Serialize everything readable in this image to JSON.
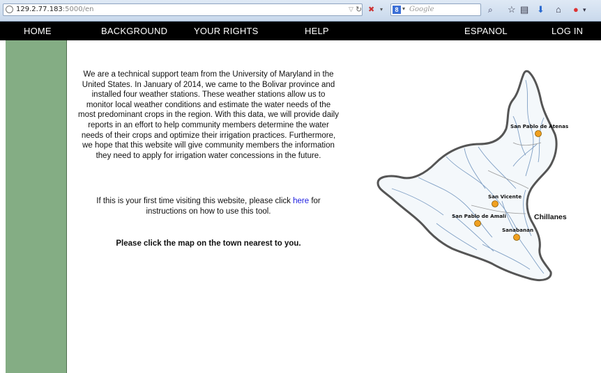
{
  "browser": {
    "url_host": "129.2.77.183",
    "url_rest": ":5000/en",
    "search_placeholder": "Google",
    "search_engine_letter": "8"
  },
  "nav": {
    "home": "HOME",
    "background": "BACKGROUND",
    "your_rights": "YOUR RIGHTS",
    "help": "HELP",
    "espanol": "ESPANOL",
    "login": "LOG IN"
  },
  "content": {
    "intro": "We are a technical support team from the University of Maryland in the United States. In January of 2014, we came to the Bolivar province and installed four weather stations. These weather stations allow us to monitor local weather conditions and estimate the water needs of the most predominant crops in the region. With this data, we will provide daily reports in an effort to help community members determine the water needs of their crops and optimize their irrigation practices. Furthermore, we hope that this website will give community members the information they need to apply for irrigation water concessions in the future.",
    "first_time_before": "If this is your first time visiting this website, please click ",
    "first_time_link": "here",
    "first_time_after": " for instructions on how to use this tool.",
    "instruction": "Please click the map on the town nearest to you."
  },
  "map": {
    "towns": [
      {
        "name": "San Pablo de Atenas"
      },
      {
        "name": "San Vicente"
      },
      {
        "name": "San Pablo de Amali"
      },
      {
        "name": "Sanabanan"
      }
    ],
    "region_label": "Chillanes",
    "station_color": "#f0a020",
    "outline_color": "#555555",
    "river_color": "#7f9fc4"
  },
  "colors": {
    "nav_bg": "#000000",
    "sidebar_bg": "#84ad84",
    "link": "#1a1ae0"
  }
}
